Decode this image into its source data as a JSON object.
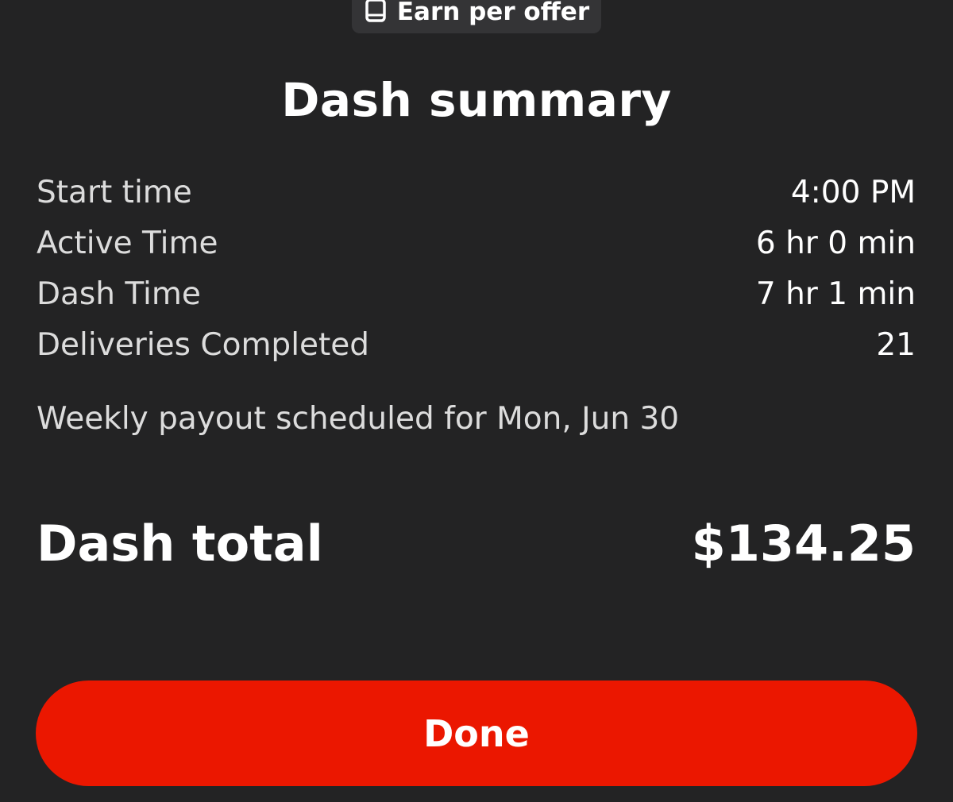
{
  "header": {
    "earn_mode_label": "Earn per offer",
    "earn_mode_icon": "phone-icon"
  },
  "summary": {
    "title": "Dash summary",
    "stats": [
      {
        "label": "Start time",
        "value": "4:00 PM"
      },
      {
        "label": "Active Time",
        "value": "6 hr 0 min"
      },
      {
        "label": "Dash Time",
        "value": "7 hr 1 min"
      },
      {
        "label": "Deliveries Completed",
        "value": "21"
      }
    ],
    "payout_note": "Weekly payout scheduled for Mon, Jun 30",
    "total_label": "Dash total",
    "total_value": "$134.25"
  },
  "actions": {
    "done_label": "Done"
  },
  "colors": {
    "background": "#232324",
    "pill_background": "#343436",
    "accent": "#eb1700",
    "text_primary": "#ffffff",
    "text_secondary": "#dcdcdc"
  }
}
